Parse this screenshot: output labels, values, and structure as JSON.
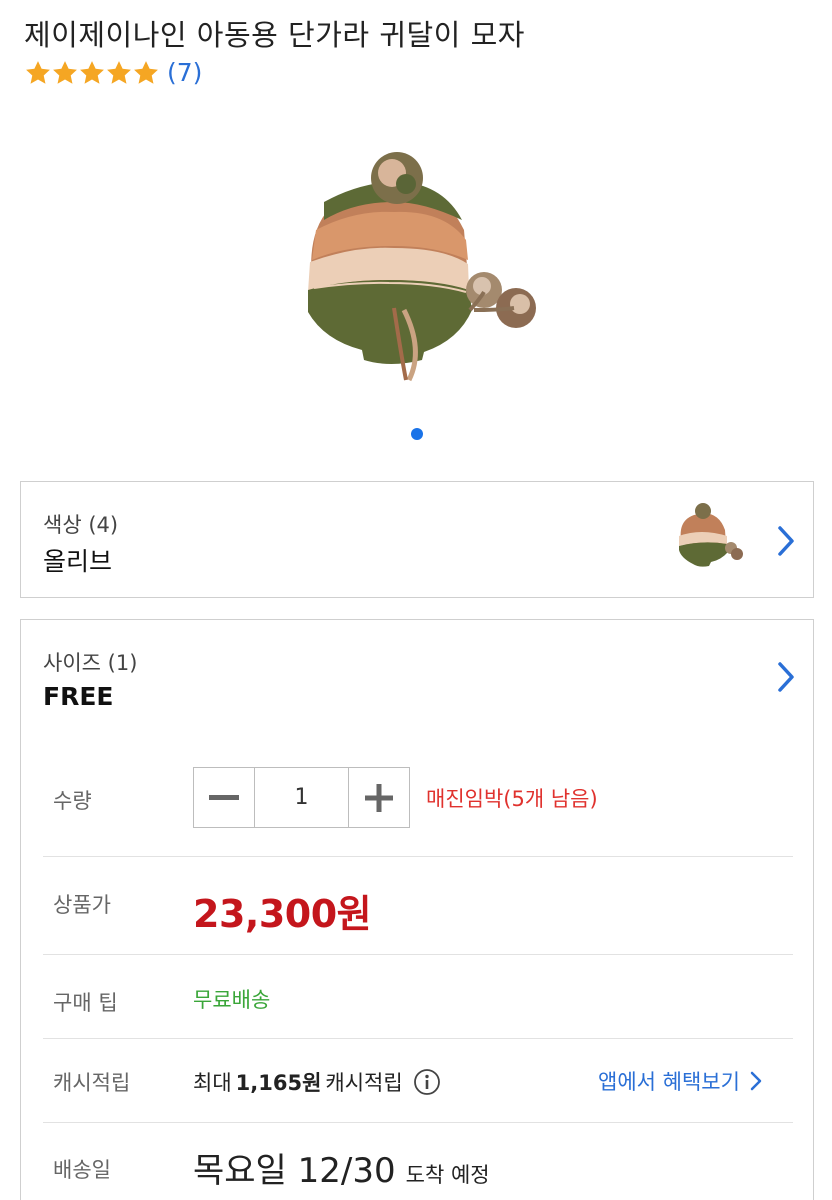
{
  "product": {
    "title": "제이제이나인 아동용 단가라 귀달이 모자",
    "rating_stars": 5,
    "review_count": "(7)"
  },
  "gallery": {
    "image_count": 1,
    "active_index": 0
  },
  "options": {
    "color": {
      "label": "색상 (4)",
      "value": "올리브"
    },
    "size": {
      "label": "사이즈 (1)",
      "value": "FREE"
    }
  },
  "quantity": {
    "label": "수량",
    "value": "1",
    "stock_notice": "매진임박(5개 남음)"
  },
  "price": {
    "label": "상품가",
    "value": "23,300원"
  },
  "tip": {
    "label": "구매 팁",
    "value": "무료배송"
  },
  "cashback": {
    "label": "캐시적립",
    "prefix": "최대",
    "amount": "1,165원",
    "suffix": "캐시적립",
    "app_link": "앱에서 혜택보기"
  },
  "delivery": {
    "label": "배송일",
    "date": "목요일 12/30",
    "suffix": "도착 예정"
  },
  "colors": {
    "accent_blue": "#2a6fd6",
    "price_red": "#c4161c",
    "stock_red": "#e0322e",
    "free_ship_green": "#3aa639",
    "star_orange": "#f5a623"
  }
}
